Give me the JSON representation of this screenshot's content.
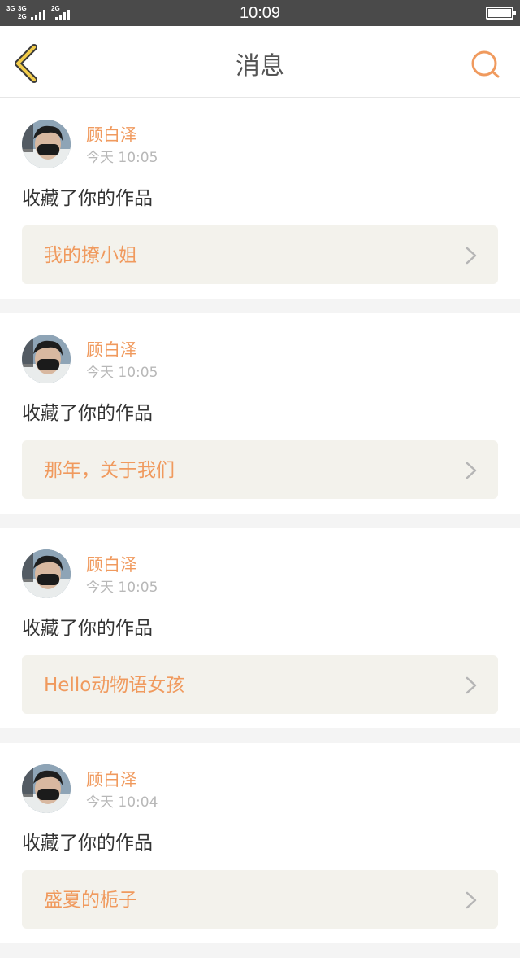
{
  "status_bar": {
    "network_labels": [
      "3G",
      "3G",
      "2G",
      "2G"
    ],
    "time": "10:09",
    "battery_level": 1.0
  },
  "nav": {
    "title": "消息",
    "back_icon": "chevron-left-icon",
    "search_icon": "search-icon",
    "accent_color": "#f09a5e"
  },
  "messages": [
    {
      "user": "顾白泽",
      "time": "今天 10:05",
      "action": "收藏了你的作品",
      "work": "我的撩小姐"
    },
    {
      "user": "顾白泽",
      "time": "今天 10:05",
      "action": "收藏了你的作品",
      "work": "那年，关于我们"
    },
    {
      "user": "顾白泽",
      "time": "今天 10:05",
      "action": "收藏了你的作品",
      "work": "Hello动物语女孩"
    },
    {
      "user": "顾白泽",
      "time": "今天 10:04",
      "action": "收藏了你的作品",
      "work": "盛夏的栀子"
    }
  ]
}
